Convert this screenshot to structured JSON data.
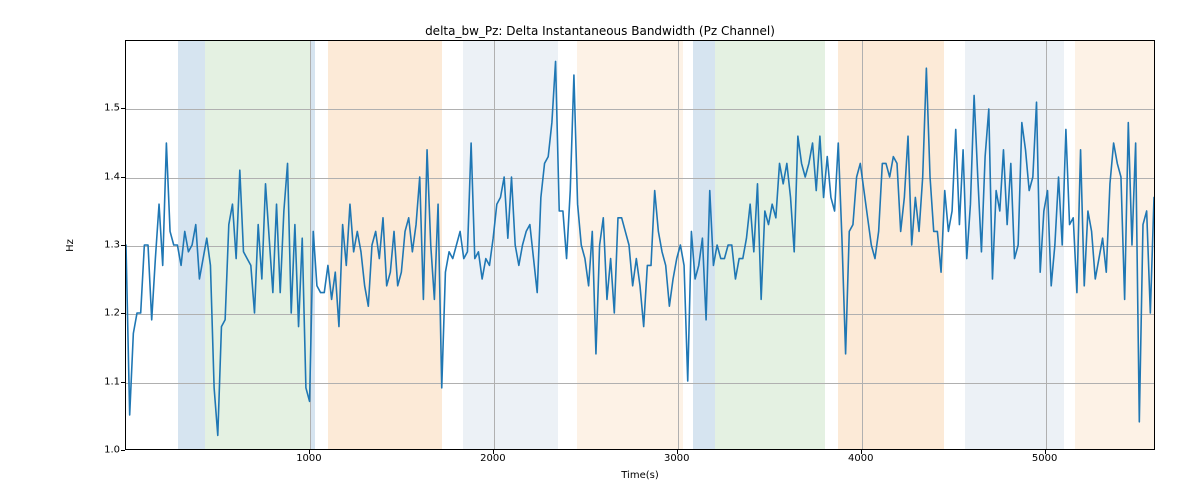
{
  "chart_data": {
    "type": "line",
    "title": "delta_bw_Pz: Delta Instantaneous Bandwidth (Pz Channel)",
    "xlabel": "Time(s)",
    "ylabel": "Hz",
    "xlim": [
      0,
      5600
    ],
    "ylim": [
      1.0,
      1.6
    ],
    "x_ticks": [
      1000,
      2000,
      3000,
      4000,
      5000
    ],
    "y_ticks": [
      1.0,
      1.1,
      1.2,
      1.3,
      1.4,
      1.5
    ],
    "line_color": "#1f77b4",
    "grid": true,
    "bands": [
      {
        "x0": 280,
        "x1": 430,
        "color": "#b4cee3"
      },
      {
        "x0": 430,
        "x1": 1000,
        "color": "#cee5cb"
      },
      {
        "x0": 1000,
        "x1": 1030,
        "color": "#b4cee3"
      },
      {
        "x0": 1100,
        "x1": 1720,
        "color": "#fad9b6"
      },
      {
        "x0": 1830,
        "x1": 2350,
        "color": "#dde6ef"
      },
      {
        "x0": 2450,
        "x1": 3030,
        "color": "#fce7d2"
      },
      {
        "x0": 3080,
        "x1": 3200,
        "color": "#b4cee3"
      },
      {
        "x0": 3200,
        "x1": 3800,
        "color": "#cee5cb"
      },
      {
        "x0": 3870,
        "x1": 4450,
        "color": "#fad9b6"
      },
      {
        "x0": 4560,
        "x1": 5100,
        "color": "#dde6ef"
      },
      {
        "x0": 5160,
        "x1": 5600,
        "color": "#fce7d2"
      }
    ],
    "series": [
      {
        "name": "delta_bw_Pz",
        "x": [
          0,
          20,
          40,
          60,
          80,
          100,
          120,
          140,
          160,
          180,
          200,
          220,
          240,
          260,
          280,
          300,
          320,
          340,
          360,
          380,
          400,
          420,
          440,
          460,
          480,
          500,
          520,
          540,
          560,
          580,
          600,
          620,
          640,
          660,
          680,
          700,
          720,
          740,
          760,
          780,
          800,
          820,
          840,
          860,
          880,
          900,
          920,
          940,
          960,
          980,
          1000,
          1020,
          1040,
          1060,
          1080,
          1100,
          1120,
          1140,
          1160,
          1180,
          1200,
          1220,
          1240,
          1260,
          1280,
          1300,
          1320,
          1340,
          1360,
          1380,
          1400,
          1420,
          1440,
          1460,
          1480,
          1500,
          1520,
          1540,
          1560,
          1580,
          1600,
          1620,
          1640,
          1660,
          1680,
          1700,
          1720,
          1740,
          1760,
          1780,
          1800,
          1820,
          1840,
          1860,
          1880,
          1900,
          1920,
          1940,
          1960,
          1980,
          2000,
          2020,
          2040,
          2060,
          2080,
          2100,
          2120,
          2140,
          2160,
          2180,
          2200,
          2220,
          2240,
          2260,
          2280,
          2300,
          2320,
          2340,
          2360,
          2380,
          2400,
          2420,
          2440,
          2460,
          2480,
          2500,
          2520,
          2540,
          2560,
          2580,
          2600,
          2620,
          2640,
          2660,
          2680,
          2700,
          2720,
          2740,
          2760,
          2780,
          2800,
          2820,
          2840,
          2860,
          2880,
          2900,
          2920,
          2940,
          2960,
          2980,
          3000,
          3020,
          3040,
          3060,
          3080,
          3100,
          3120,
          3140,
          3160,
          3180,
          3200,
          3220,
          3240,
          3260,
          3280,
          3300,
          3320,
          3340,
          3360,
          3380,
          3400,
          3420,
          3440,
          3460,
          3480,
          3500,
          3520,
          3540,
          3560,
          3580,
          3600,
          3620,
          3640,
          3660,
          3680,
          3700,
          3720,
          3740,
          3760,
          3780,
          3800,
          3820,
          3840,
          3860,
          3880,
          3900,
          3920,
          3940,
          3960,
          3980,
          4000,
          4020,
          4040,
          4060,
          4080,
          4100,
          4120,
          4140,
          4160,
          4180,
          4200,
          4220,
          4240,
          4260,
          4280,
          4300,
          4320,
          4340,
          4360,
          4380,
          4400,
          4420,
          4440,
          4460,
          4480,
          4500,
          4520,
          4540,
          4560,
          4580,
          4600,
          4620,
          4640,
          4660,
          4680,
          4700,
          4720,
          4740,
          4760,
          4780,
          4800,
          4820,
          4840,
          4860,
          4880,
          4900,
          4920,
          4940,
          4960,
          4980,
          5000,
          5020,
          5040,
          5060,
          5080,
          5100,
          5120,
          5140,
          5160,
          5180,
          5200,
          5220,
          5240,
          5260,
          5280,
          5300,
          5320,
          5340,
          5360,
          5380,
          5400,
          5420,
          5440,
          5460,
          5480,
          5500,
          5520,
          5540,
          5560,
          5580,
          5600
        ],
        "values": [
          1.3,
          1.05,
          1.17,
          1.2,
          1.2,
          1.3,
          1.3,
          1.19,
          1.28,
          1.36,
          1.27,
          1.45,
          1.32,
          1.3,
          1.3,
          1.27,
          1.32,
          1.29,
          1.3,
          1.33,
          1.25,
          1.28,
          1.31,
          1.27,
          1.09,
          1.02,
          1.18,
          1.19,
          1.33,
          1.36,
          1.28,
          1.41,
          1.29,
          1.28,
          1.27,
          1.2,
          1.33,
          1.25,
          1.39,
          1.31,
          1.23,
          1.36,
          1.23,
          1.35,
          1.42,
          1.2,
          1.33,
          1.18,
          1.31,
          1.09,
          1.07,
          1.32,
          1.24,
          1.23,
          1.23,
          1.27,
          1.22,
          1.26,
          1.18,
          1.33,
          1.27,
          1.36,
          1.29,
          1.32,
          1.29,
          1.24,
          1.21,
          1.3,
          1.32,
          1.28,
          1.34,
          1.24,
          1.26,
          1.32,
          1.24,
          1.26,
          1.32,
          1.34,
          1.29,
          1.33,
          1.4,
          1.22,
          1.44,
          1.3,
          1.22,
          1.36,
          1.09,
          1.26,
          1.29,
          1.28,
          1.3,
          1.32,
          1.28,
          1.29,
          1.45,
          1.28,
          1.29,
          1.25,
          1.28,
          1.27,
          1.31,
          1.36,
          1.37,
          1.4,
          1.31,
          1.4,
          1.3,
          1.27,
          1.3,
          1.32,
          1.33,
          1.28,
          1.23,
          1.37,
          1.42,
          1.43,
          1.48,
          1.57,
          1.35,
          1.35,
          1.28,
          1.38,
          1.55,
          1.36,
          1.3,
          1.28,
          1.24,
          1.32,
          1.14,
          1.3,
          1.34,
          1.22,
          1.28,
          1.2,
          1.34,
          1.34,
          1.32,
          1.3,
          1.24,
          1.28,
          1.24,
          1.18,
          1.27,
          1.27,
          1.38,
          1.32,
          1.29,
          1.27,
          1.21,
          1.25,
          1.28,
          1.3,
          1.27,
          1.1,
          1.32,
          1.25,
          1.27,
          1.31,
          1.19,
          1.38,
          1.27,
          1.3,
          1.28,
          1.28,
          1.3,
          1.3,
          1.25,
          1.28,
          1.28,
          1.31,
          1.36,
          1.29,
          1.39,
          1.22,
          1.35,
          1.33,
          1.36,
          1.34,
          1.42,
          1.39,
          1.42,
          1.37,
          1.29,
          1.46,
          1.42,
          1.4,
          1.42,
          1.45,
          1.38,
          1.46,
          1.37,
          1.43,
          1.37,
          1.35,
          1.45,
          1.31,
          1.14,
          1.32,
          1.33,
          1.4,
          1.42,
          1.38,
          1.34,
          1.3,
          1.28,
          1.32,
          1.42,
          1.42,
          1.4,
          1.43,
          1.42,
          1.32,
          1.37,
          1.46,
          1.3,
          1.37,
          1.32,
          1.4,
          1.56,
          1.4,
          1.32,
          1.32,
          1.26,
          1.38,
          1.32,
          1.35,
          1.47,
          1.33,
          1.44,
          1.28,
          1.36,
          1.52,
          1.4,
          1.29,
          1.43,
          1.5,
          1.25,
          1.38,
          1.35,
          1.44,
          1.33,
          1.42,
          1.28,
          1.3,
          1.48,
          1.44,
          1.38,
          1.4,
          1.51,
          1.26,
          1.35,
          1.38,
          1.24,
          1.3,
          1.4,
          1.3,
          1.47,
          1.33,
          1.34,
          1.23,
          1.44,
          1.24,
          1.35,
          1.32,
          1.25,
          1.28,
          1.31,
          1.26,
          1.39,
          1.45,
          1.42,
          1.4,
          1.22,
          1.48,
          1.3,
          1.45,
          1.04,
          1.33,
          1.35,
          1.2,
          1.37
        ]
      }
    ]
  }
}
